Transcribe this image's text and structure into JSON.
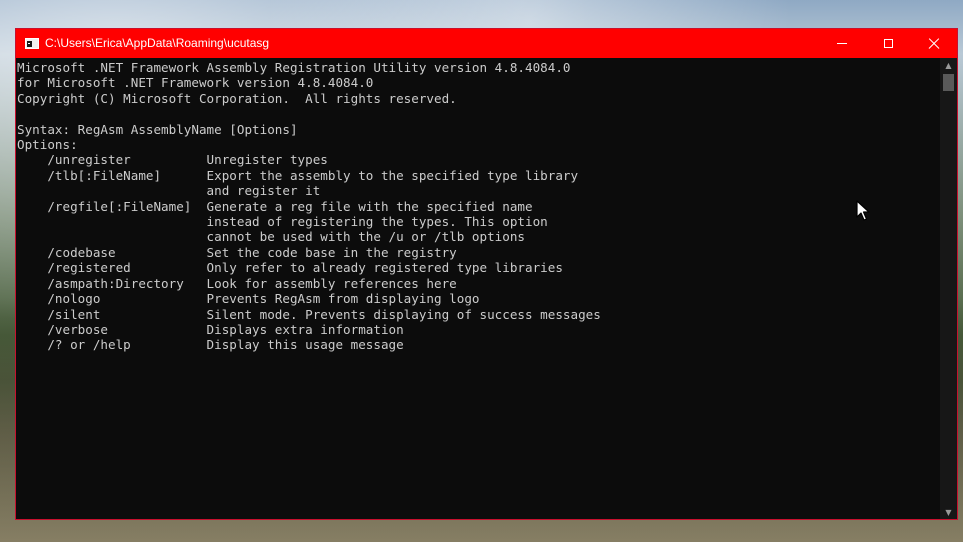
{
  "window": {
    "title": "C:\\Users\\Erica\\AppData\\Roaming\\ucutasg",
    "title_bar_color": "#ff0000",
    "minimize_label": "",
    "maximize_label": "",
    "close_label": ""
  },
  "console": {
    "background": "#0c0c0c",
    "foreground": "#cccccc",
    "lines": [
      "Microsoft .NET Framework Assembly Registration Utility version 4.8.4084.0",
      "for Microsoft .NET Framework version 4.8.4084.0",
      "Copyright (C) Microsoft Corporation.  All rights reserved.",
      "",
      "Syntax: RegAsm AssemblyName [Options]",
      "Options:",
      "    /unregister          Unregister types",
      "    /tlb[:FileName]      Export the assembly to the specified type library",
      "                         and register it",
      "    /regfile[:FileName]  Generate a reg file with the specified name",
      "                         instead of registering the types. This option",
      "                         cannot be used with the /u or /tlb options",
      "    /codebase            Set the code base in the registry",
      "    /registered          Only refer to already registered type libraries",
      "    /asmpath:Directory   Look for assembly references here",
      "    /nologo              Prevents RegAsm from displaying logo",
      "    /silent              Silent mode. Prevents displaying of success messages",
      "    /verbose             Displays extra information",
      "    /? or /help          Display this usage message"
    ]
  },
  "icons": {
    "app": "console-app-icon",
    "minimize": "minimize-icon",
    "maximize": "maximize-icon",
    "close": "close-icon",
    "scroll_up": "scroll-up-arrow-icon",
    "scroll_down": "scroll-down-arrow-icon",
    "cursor": "mouse-pointer-icon"
  }
}
